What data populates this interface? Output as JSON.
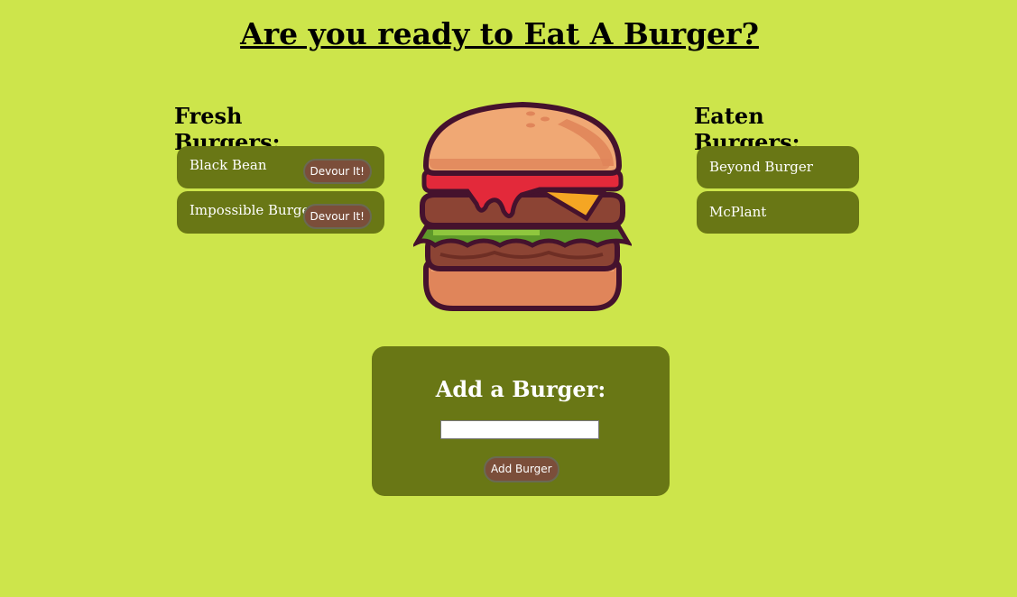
{
  "header": {
    "title": "Are you ready to Eat A Burger?"
  },
  "fresh": {
    "heading": "Fresh Burgers:",
    "items": [
      {
        "name": "Black Bean",
        "button_label": "Devour It!"
      },
      {
        "name": "Impossible Burger",
        "button_label": "Devour It!"
      }
    ]
  },
  "eaten": {
    "heading": "Eaten Burgers:",
    "items": [
      {
        "name": "Beyond Burger"
      },
      {
        "name": "McPlant"
      }
    ]
  },
  "hero": {
    "icon": "burger-icon"
  },
  "add_form": {
    "heading": "Add a Burger:",
    "input_value": "",
    "input_placeholder": "",
    "button_label": "Add Burger"
  },
  "colors": {
    "page_background": "#cde54b",
    "panel": "#697715",
    "button": "#7b4e3a",
    "text_light": "#ffffff"
  }
}
